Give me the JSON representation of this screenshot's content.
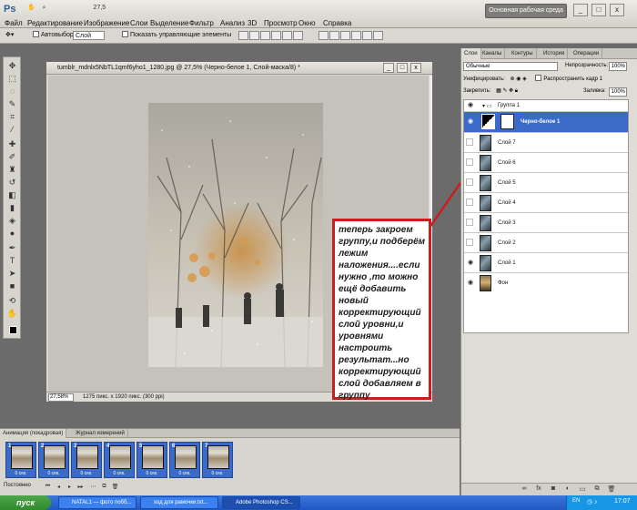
{
  "app": {
    "logo": "Ps",
    "zoom": "27,5",
    "workspace_button": "Основная рабочая среда",
    "menu": [
      "Файл",
      "Редактирование",
      "Изображение",
      "Слои",
      "Выделение",
      "Фильтр",
      "Анализ",
      "3D",
      "Просмотр",
      "Окно",
      "Справка"
    ],
    "window_buttons": [
      "_",
      "□",
      "x"
    ]
  },
  "options_bar": {
    "autoselect_label": "Автовыбор:",
    "autoselect_value": "Слой",
    "show_controls_label": "Показать управляющие элементы"
  },
  "document": {
    "title": "tumblr_mdnlx5NbTL1qmf6yho1_1280.jpg @ 27,5% (Черно-белое 1, Слой-маска/8) *",
    "zoom_field": "27,58%",
    "info": "1275 пикс. x 1920 пикс. (300 ppi)"
  },
  "annotation": {
    "text": "теперь закроем группу,и подберём лежим наложения....если нужно ,то можно ещё добавить новый корректирующий слой уровни,и уровнями настроить результат...но корректирующий слой добавляем в группу",
    "border_color": "#c42020"
  },
  "layers_panel": {
    "tabs": [
      "Слои",
      "Каналы",
      "Контуры",
      "История",
      "Операции"
    ],
    "blend_mode": "Обычные",
    "opacity_label": "Непрозрачность:",
    "opacity_value": "100%",
    "unify_label": "Унифицировать:",
    "propagate_label": "Распространить кадр 1",
    "lock_label": "Закрепить:",
    "fill_label": "Заливка:",
    "fill_value": "100%",
    "group_name": "Группа 1",
    "selected_layer": "Черно-белое 1",
    "layers": [
      "Слой 7",
      "Слой 6",
      "Слой 5",
      "Слой 4",
      "Слой 3",
      "Слой 2",
      "Слой 1",
      "Фон"
    ],
    "selection_color": "#3a6bc8"
  },
  "animation_panel": {
    "tabs": [
      "Анимация (покадровая)",
      "Журнал измерений"
    ],
    "frames": [
      {
        "num": "1",
        "delay": "0 сек."
      },
      {
        "num": "2",
        "delay": "0 сек."
      },
      {
        "num": "3",
        "delay": "0 сек."
      },
      {
        "num": "4",
        "delay": "0 сек."
      },
      {
        "num": "5",
        "delay": "0 сек."
      },
      {
        "num": "6",
        "delay": "0 сек."
      },
      {
        "num": "7",
        "delay": "0 сек."
      }
    ],
    "loop": "Постоянно"
  },
  "taskbar": {
    "start": "пуск",
    "buttons": [
      "NATAL1 — фото побб...",
      "ход для рамочки.txt...",
      "Adobe Photoshop CS..."
    ],
    "lang": "EN",
    "clock": "17:07"
  }
}
